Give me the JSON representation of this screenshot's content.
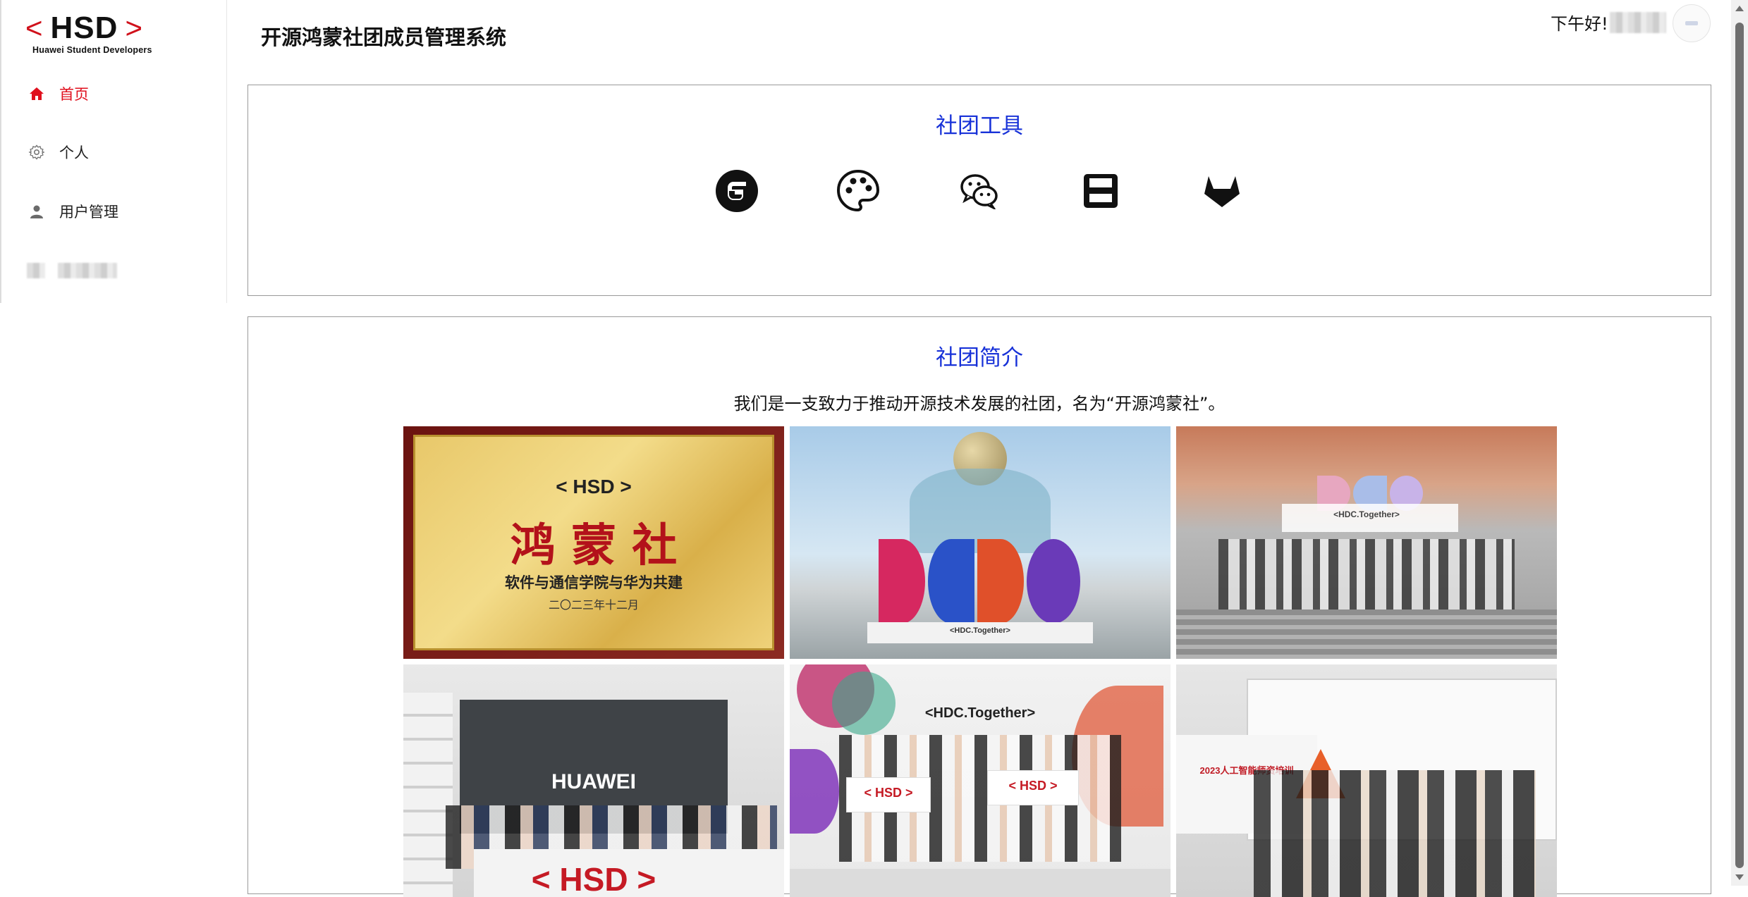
{
  "app": {
    "title": "开源鸿蒙社团成员管理系统",
    "logo": {
      "main": "HSD",
      "subtitle": "Huawei Student Developers",
      "bracket_left": "<",
      "bracket_right": ">"
    }
  },
  "header": {
    "greeting": "下午好!",
    "avatar_icon": "user-avatar-icon"
  },
  "sidebar": {
    "items": [
      {
        "label": "首页",
        "icon": "home-icon",
        "active": true
      },
      {
        "label": "个人",
        "icon": "gear-icon",
        "active": false
      },
      {
        "label": "用户管理",
        "icon": "user-icon",
        "active": false
      }
    ]
  },
  "tools_card": {
    "title": "社团工具",
    "tools": [
      {
        "icon": "gitee-icon"
      },
      {
        "icon": "palette-icon"
      },
      {
        "icon": "wechat-icon"
      },
      {
        "icon": "save-icon"
      },
      {
        "icon": "gitlab-icon"
      }
    ]
  },
  "intro_card": {
    "title": "社团简介",
    "text": "我们是一支致力于推动开源技术发展的社团，名为“开源鸿蒙社”。",
    "photos": [
      {
        "name": "plaque-photo",
        "caption_main": "鸿 蒙 社",
        "caption_logo": "< HSD >",
        "caption_line": "软件与通信学院与华为共建",
        "caption_date": "二〇二三年十二月"
      },
      {
        "name": "hdc-sculpture-photo",
        "caption_line": "<HDC.Together>"
      },
      {
        "name": "hdc-group-photo",
        "caption_line": "<HDC.Together>"
      },
      {
        "name": "huawei-store-photo",
        "caption_main": "HUAWEI",
        "caption_logo": "< HSD >"
      },
      {
        "name": "hdc-team-photo",
        "caption_line": "<HDC.Together>",
        "caption_logo": "< HSD >"
      },
      {
        "name": "training-photo",
        "caption_line": "2023人工智能师资培训"
      }
    ]
  },
  "colors": {
    "accent_red": "#e0101e",
    "title_blue": "#1832d8"
  }
}
